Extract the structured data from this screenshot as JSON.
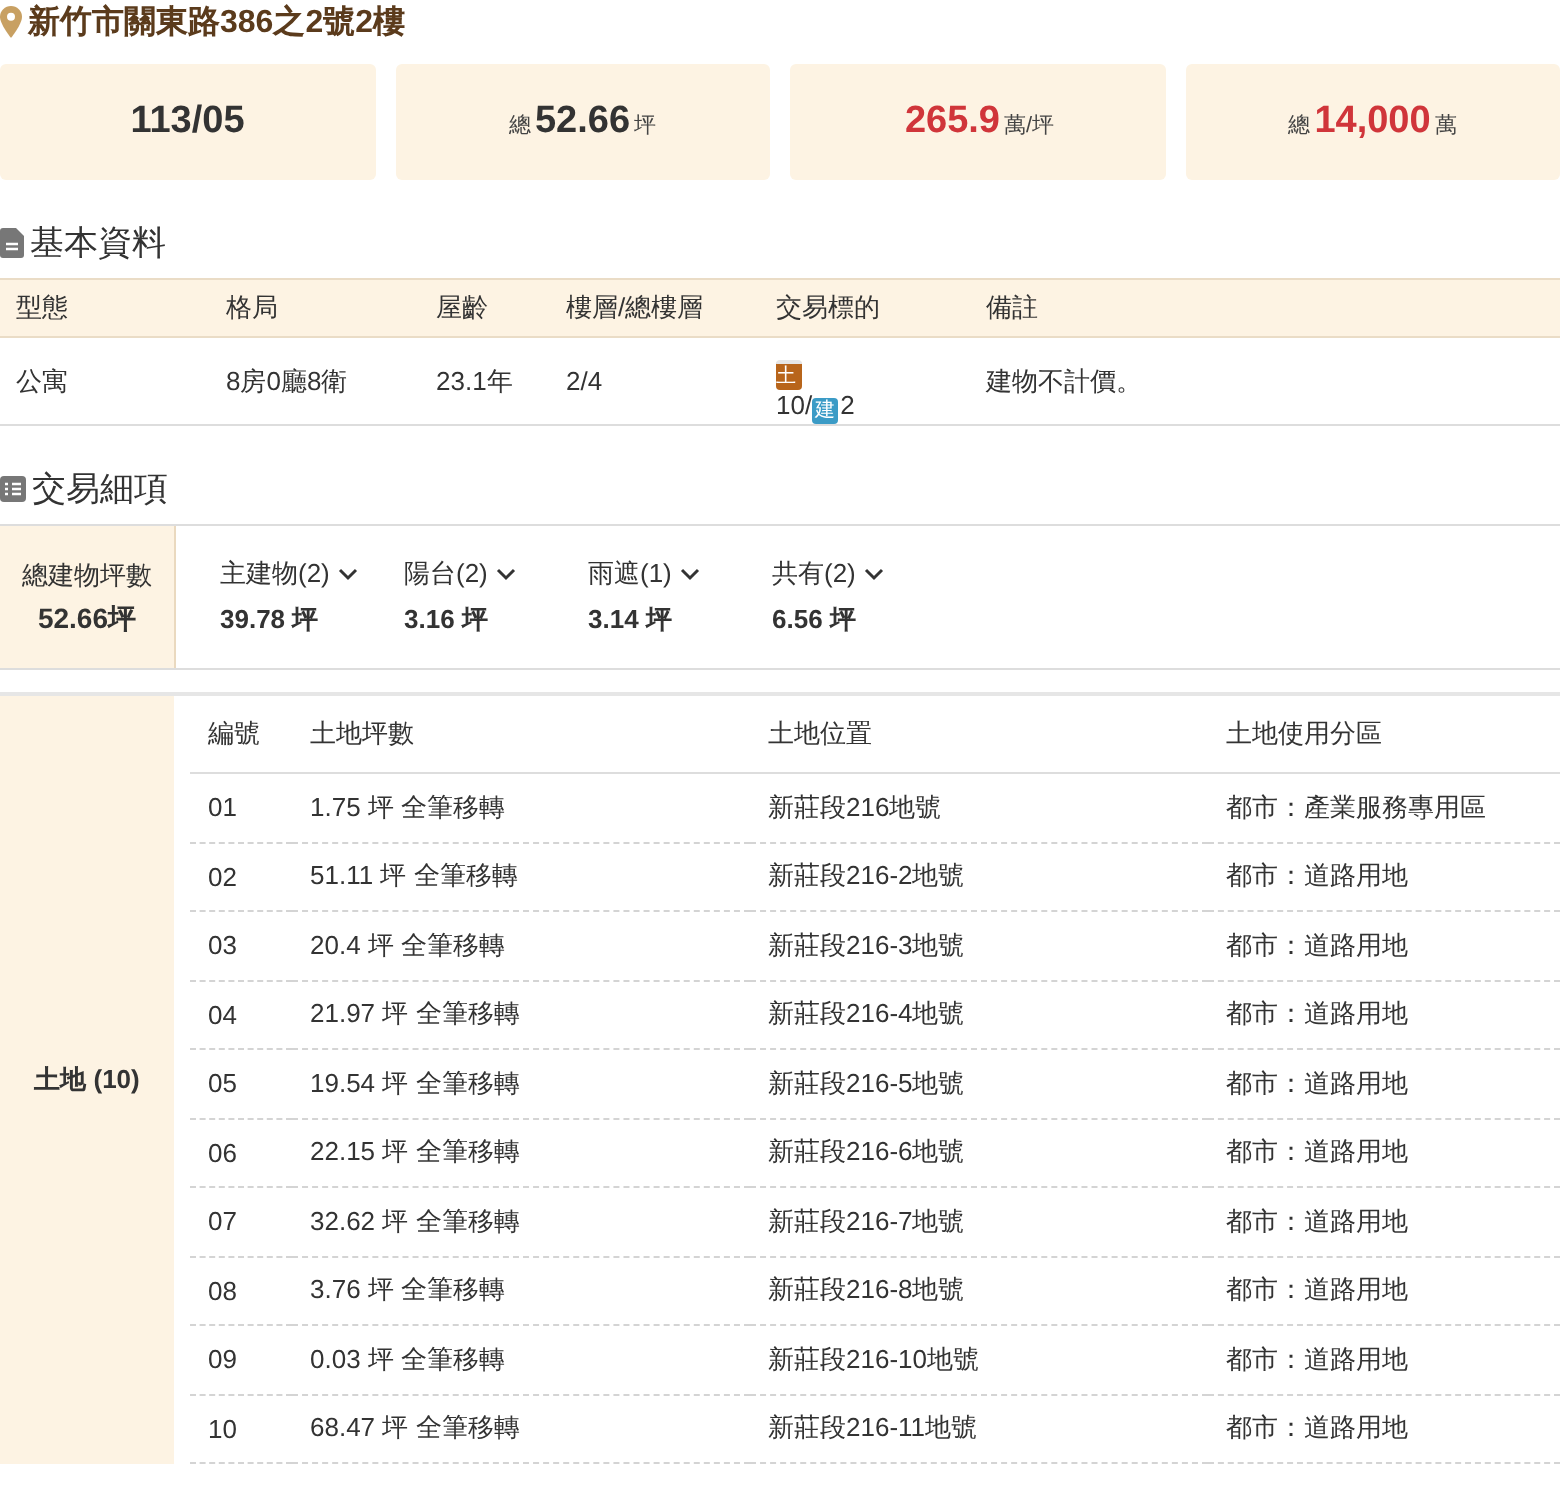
{
  "address": "新竹市關東路386之2號2樓",
  "stats": [
    {
      "kind": "plain",
      "value": "113/05"
    },
    {
      "kind": "area",
      "prefix": "總",
      "value": "52.66",
      "unit": "坪",
      "emphasis": false
    },
    {
      "kind": "area",
      "value": "265.9",
      "unit": "萬/坪",
      "emphasis": true
    },
    {
      "kind": "area",
      "prefix": "總",
      "value": "14,000",
      "unit": "萬",
      "emphasis": true
    }
  ],
  "basic": {
    "title": "基本資料",
    "columns": [
      "型態",
      "格局",
      "屋齡",
      "樓層/總樓層",
      "交易標的",
      "備註"
    ],
    "row": {
      "type": "公寓",
      "layout": "8房0廳8衛",
      "age": "23.1年",
      "floor": "2/4",
      "targets": [
        {
          "kind": "land",
          "badge": "土",
          "count": "10"
        },
        {
          "kind": "building",
          "badge": "建",
          "count": "2"
        }
      ],
      "separator": "/",
      "note": "建物不計價。"
    }
  },
  "details": {
    "title": "交易細項",
    "total": {
      "label": "總建物坪數",
      "value": "52.66坪"
    },
    "parts": [
      {
        "label": "主建物(2)",
        "value": "39.78 坪",
        "expanded": false
      },
      {
        "label": "陽台(2)",
        "value": "3.16 坪",
        "expanded": false
      },
      {
        "label": "雨遮(1)",
        "value": "3.14 坪",
        "expanded": false
      },
      {
        "label": "共有(2)",
        "value": "6.56 坪",
        "expanded": false
      }
    ],
    "land": {
      "label": "土地 (10)",
      "columns": [
        "編號",
        "土地坪數",
        "土地位置",
        "土地使用分區"
      ],
      "rows": [
        [
          "01",
          "1.75 坪 全筆移轉",
          "新莊段216地號",
          "都市：產業服務專用區"
        ],
        [
          "02",
          "51.11 坪 全筆移轉",
          "新莊段216-2地號",
          "都市：道路用地"
        ],
        [
          "03",
          "20.4 坪 全筆移轉",
          "新莊段216-3地號",
          "都市：道路用地"
        ],
        [
          "04",
          "21.97 坪 全筆移轉",
          "新莊段216-4地號",
          "都市：道路用地"
        ],
        [
          "05",
          "19.54 坪 全筆移轉",
          "新莊段216-5地號",
          "都市：道路用地"
        ],
        [
          "06",
          "22.15 坪 全筆移轉",
          "新莊段216-6地號",
          "都市：道路用地"
        ],
        [
          "07",
          "32.62 坪 全筆移轉",
          "新莊段216-7地號",
          "都市：道路用地"
        ],
        [
          "08",
          "3.76 坪 全筆移轉",
          "新莊段216-8地號",
          "都市：道路用地"
        ],
        [
          "09",
          "0.03 坪 全筆移轉",
          "新莊段216-10地號",
          "都市：道路用地"
        ],
        [
          "10",
          "68.47 坪 全筆移轉",
          "新莊段216-11地號",
          "都市：道路用地"
        ]
      ]
    }
  }
}
